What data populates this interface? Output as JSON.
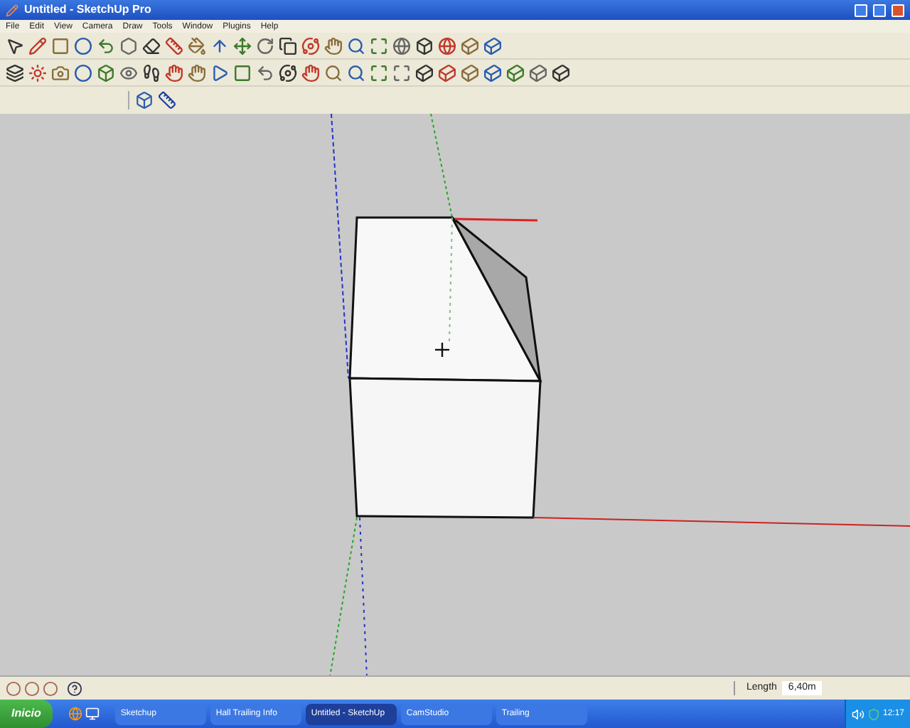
{
  "window": {
    "title": "Untitled - SketchUp Pro"
  },
  "menu": [
    "File",
    "Edit",
    "View",
    "Camera",
    "Draw",
    "Tools",
    "Window",
    "Plugins",
    "Help"
  ],
  "status_bar": {
    "measurement_label": "Length",
    "measurement_value": "6,40m"
  },
  "taskbar": {
    "start": "Inicio",
    "tasks": [
      {
        "label": "Sketchup",
        "selected": false
      },
      {
        "label": "Hall Trailing Info",
        "selected": false
      },
      {
        "label": "Untitled - SketchUp",
        "selected": true
      },
      {
        "label": "CamStudio",
        "selected": false
      },
      {
        "label": "Trailing",
        "selected": false
      }
    ],
    "clock": "12:17"
  }
}
